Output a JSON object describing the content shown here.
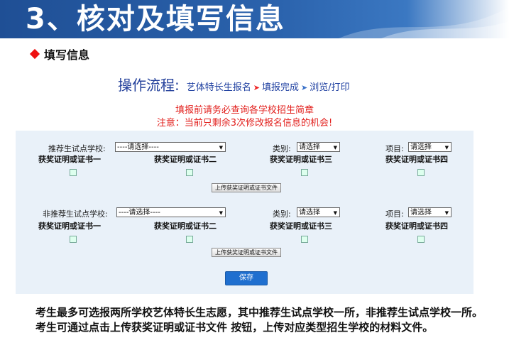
{
  "header": {
    "title": "3、核对及填写信息"
  },
  "section": {
    "label": "填写信息"
  },
  "flow": {
    "heading": "操作流程:",
    "steps": [
      "艺体特长生报名",
      "填报完成",
      "浏览/打印"
    ]
  },
  "notices": {
    "line1": "填报前请务必查询各学校招生简章",
    "line2": "注意：当前只剩余3次修改报名信息的机会!"
  },
  "recommended": {
    "school_label": "推荐生试点学校:",
    "school_value": "----请选择----",
    "category_label": "类别:",
    "category_value": "请选择",
    "item_label": "项目:",
    "item_value": "请选择",
    "certs": [
      "获奖证明或证书一",
      "获奖证明或证书二",
      "获奖证明或证书三",
      "获奖证明或证书四"
    ],
    "upload_label": "上传获奖证明或证书文件"
  },
  "non_recommended": {
    "school_label": "非推荐生试点学校:",
    "school_value": "----请选择----",
    "category_label": "类别:",
    "category_value": "请选择",
    "item_label": "项目:",
    "item_value": "请选择",
    "certs": [
      "获奖证明或证书一",
      "获奖证明或证书二",
      "获奖证明或证书三",
      "获奖证明或证书四"
    ],
    "upload_label": "上传获奖证明或证书文件"
  },
  "save_label": "保存",
  "description": "考生最多可选报两所学校艺体特长生志愿，其中推荐生试点学校一所，非推荐生试点学校一所。考生可通过点击上传获奖证明或证书文件 按钮，上传对应类型招生学校的材料文件。",
  "colors": {
    "banner": "#2b63ad",
    "accent_red": "#e2201d",
    "panel": "#e9f1f9",
    "save_button": "#1f6fcf"
  }
}
